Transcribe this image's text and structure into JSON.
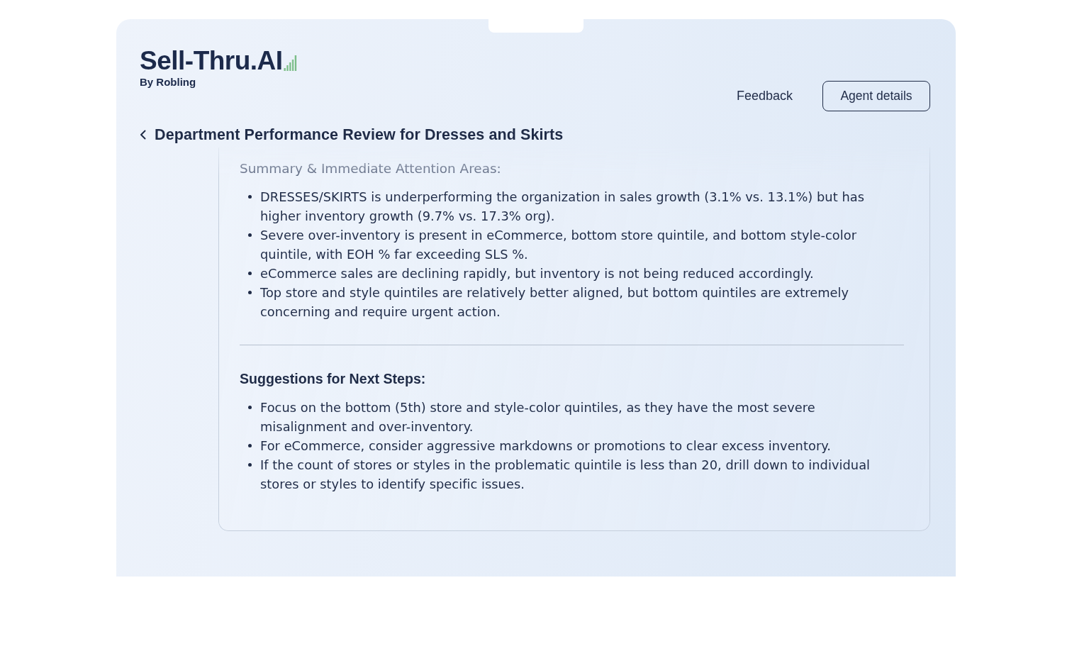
{
  "logo": {
    "name": "Sell-Thru.AI",
    "tagline": "By Robling"
  },
  "header_actions": [
    {
      "kind": "link",
      "label": "Feedback"
    },
    {
      "kind": "outlined",
      "label": "Agent details"
    }
  ],
  "page_title": "Department Performance Review for Dresses and Skirts",
  "sections": [
    {
      "kind": "muted",
      "heading": "Summary & Immediate Attention Areas:",
      "items": [
        "DRESSES/SKIRTS is underperforming the organization in sales growth (3.1% vs. 13.1%) but has higher inventory growth (9.7% vs. 17.3% org).",
        "Severe over-inventory is present in eCommerce, bottom store quintile, and bottom style-color quintile, with EOH % far exceeding SLS %.",
        "eCommerce sales are declining rapidly, but inventory is not being reduced accordingly.",
        "Top store and style quintiles are relatively better aligned, but bottom quintiles are extremely concerning and require urgent action."
      ]
    },
    {
      "kind": "strong",
      "heading": "Suggestions for Next Steps:",
      "items": [
        "Focus on the bottom (5th) store and style-color quintiles, as they have the most severe misalignment and over-inventory.",
        "For eCommerce, consider aggressive markdowns or promotions to clear excess inventory.",
        "If the count of stores or styles in the problematic quintile is less than 20, drill down to individual stores or styles to identify specific issues."
      ]
    }
  ]
}
